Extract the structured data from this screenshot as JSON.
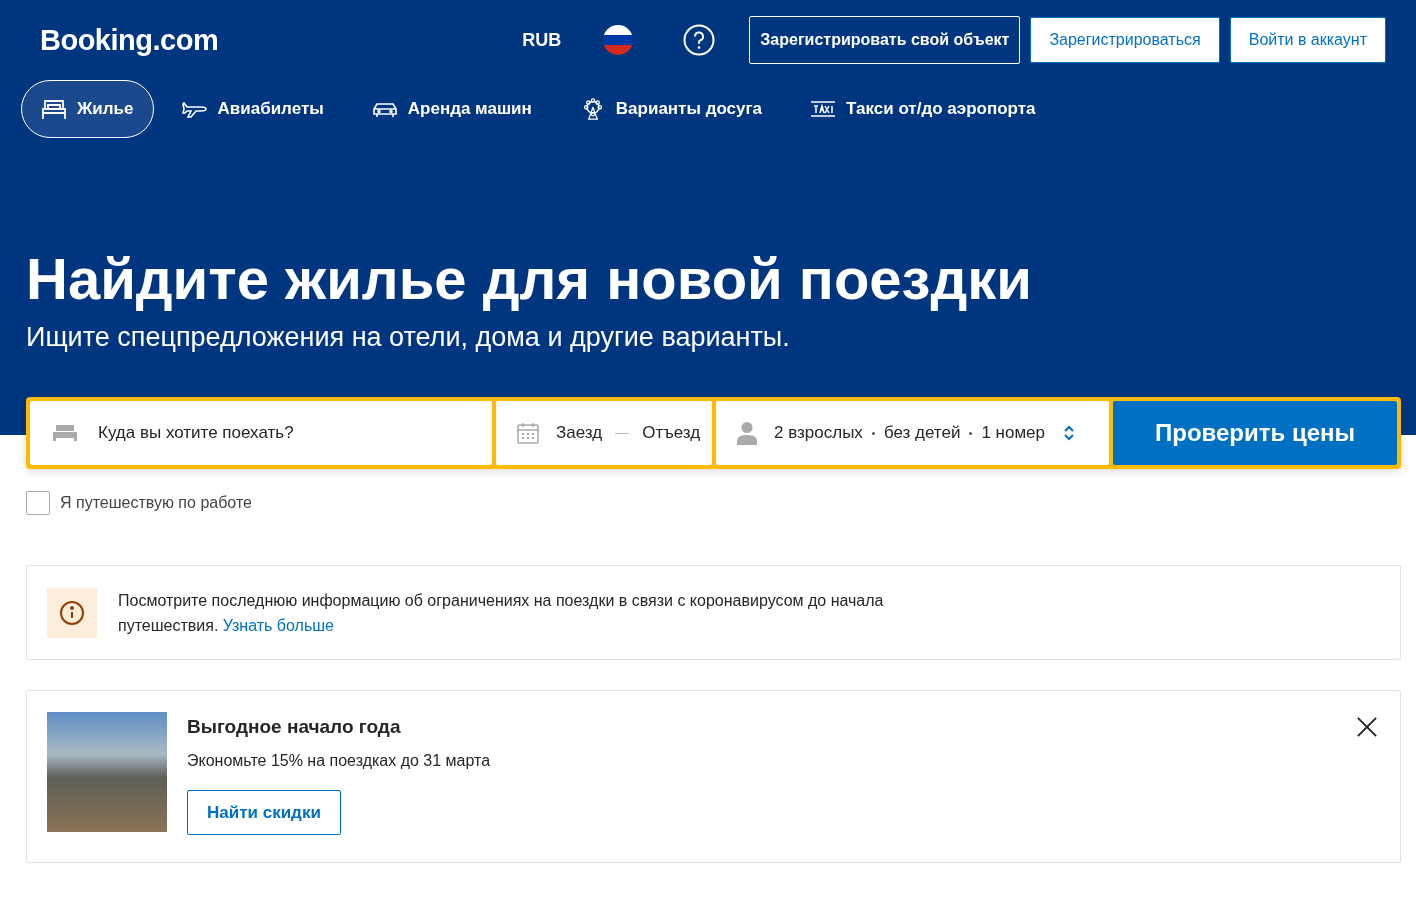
{
  "header": {
    "logo": "Booking.com",
    "currency": "RUB",
    "buttons": [
      {
        "label": "Зарегистрировать свой объект",
        "kind": "outline"
      },
      {
        "label": "Зарегистрироваться",
        "kind": "white"
      },
      {
        "label": "Войти в аккаунт",
        "kind": "white"
      }
    ]
  },
  "nav": [
    {
      "label": "Жилье",
      "kind": "stays",
      "selected": true
    },
    {
      "label": "Авиабилеты",
      "kind": "flights",
      "selected": false
    },
    {
      "label": "Аренда машин",
      "kind": "cars",
      "selected": false
    },
    {
      "label": "Варианты досуга",
      "kind": "attractions",
      "selected": false
    },
    {
      "label": "Такси от/до аэропорта",
      "kind": "taxi",
      "selected": false
    }
  ],
  "hero": {
    "title": "Найдите жилье для новой поездки",
    "subtitle": "Ищите спецпредложения на отели, дома и другие варианты."
  },
  "search": {
    "destination": {
      "placeholder": "Куда вы хотите поехать?"
    },
    "checkin": "Заезд",
    "checkout": "Отъезд",
    "guests": [
      "2 взрослых",
      "без детей",
      "1 номер"
    ],
    "submit": "Проверить цены"
  },
  "business_trip": {
    "label": "Я путешествую по работе",
    "checked": false
  },
  "notice": {
    "text": "Посмотрите последнюю информацию об ограничениях на поездки в связи с коронавирусом до начала путешествия.",
    "link": "Узнать больше"
  },
  "promo": {
    "title": "Выгодное начало года",
    "text": "Экономьте 15% на поездках до 31 марта",
    "button": "Найти скидки"
  }
}
